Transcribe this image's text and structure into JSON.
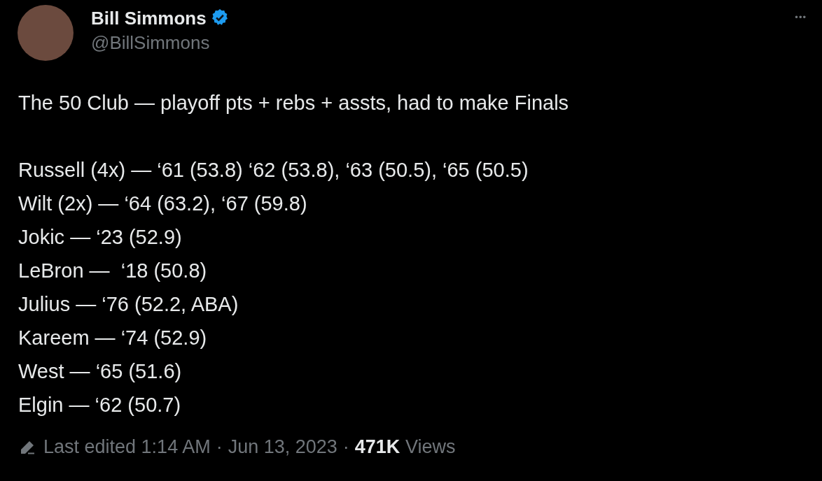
{
  "author": {
    "name": "Bill Simmons",
    "handle": "@BillSimmons",
    "verified": true
  },
  "more_button": "•••",
  "body": {
    "headline": "The 50 Club — playoff pts + rebs + assts, had to make Finals",
    "lines": [
      "Russell (4x) — ‘61 (53.8) ‘62 (53.8), ‘63 (50.5), ‘65 (50.5)",
      "Wilt (2x) — ‘64 (63.2), ‘67 (59.8)",
      "Jokic — ‘23 (52.9)",
      "LeBron —  ‘18 (50.8)",
      "Julius — ‘76 (52.2, ABA)",
      "Kareem — ‘74 (52.9)",
      "West — ‘65 (51.6)",
      "Elgin — ‘62 (50.7)"
    ]
  },
  "footer": {
    "edited": "Last edited 1:14 AM",
    "separator_1": "·",
    "date": "Jun 13, 2023",
    "separator_2": "·",
    "views_count": "471K",
    "views_label": "Views"
  }
}
